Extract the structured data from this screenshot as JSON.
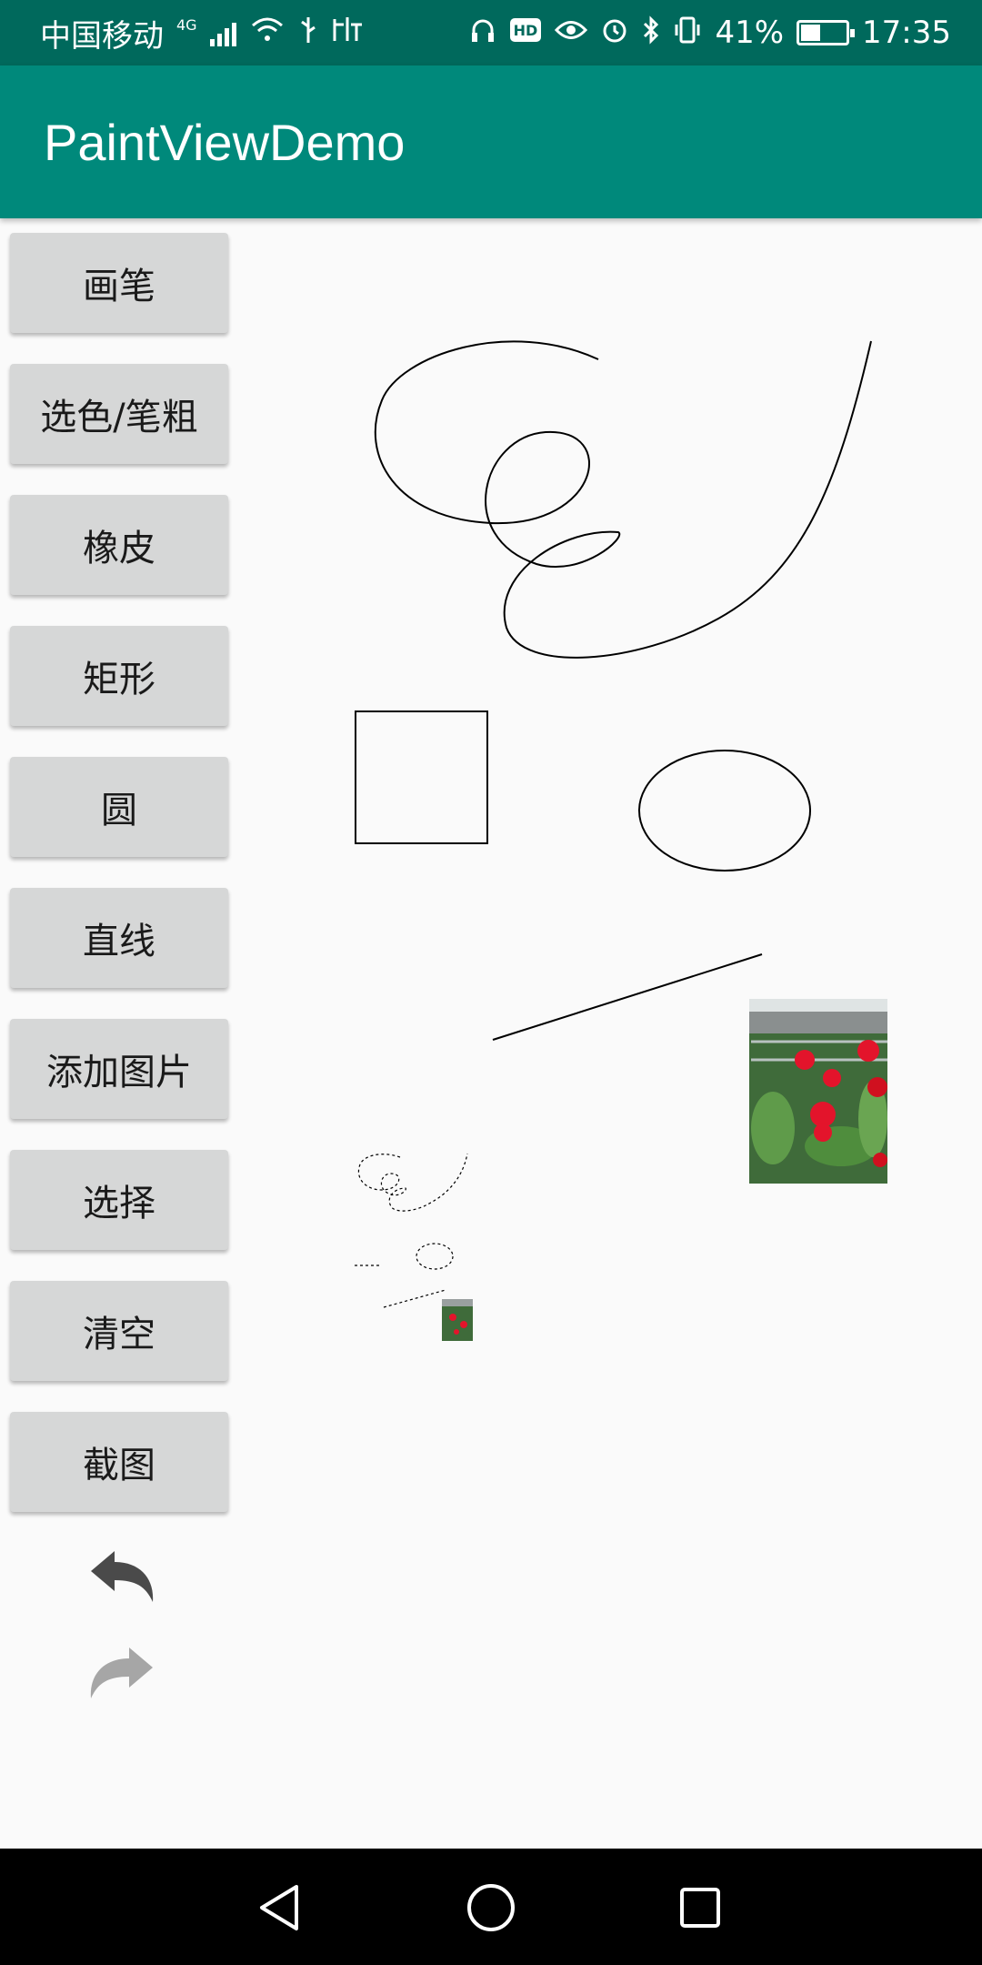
{
  "status_bar": {
    "carrier": "中国移动",
    "network": "4G",
    "battery_percent": "41%",
    "time": "17:35",
    "icons": [
      "signal-icon",
      "wifi-icon",
      "usb-icon",
      "headphones-icon",
      "hd-icon",
      "eye-icon",
      "alarm-icon",
      "bluetooth-icon",
      "vibrate-icon",
      "battery-icon"
    ]
  },
  "app_bar": {
    "title": "PaintViewDemo"
  },
  "tools": {
    "pen": "画笔",
    "color_width": "选色/笔粗",
    "eraser": "橡皮",
    "rect": "矩形",
    "circle": "圆",
    "line": "直线",
    "add_image": "添加图片",
    "select": "选择",
    "clear": "清空",
    "screenshot": "截图"
  },
  "colors": {
    "status_bar": "#00695c",
    "app_bar": "#00897b",
    "button_bg": "#d6d7d7",
    "canvas_bg": "#fafafa",
    "stroke": "#000000"
  }
}
